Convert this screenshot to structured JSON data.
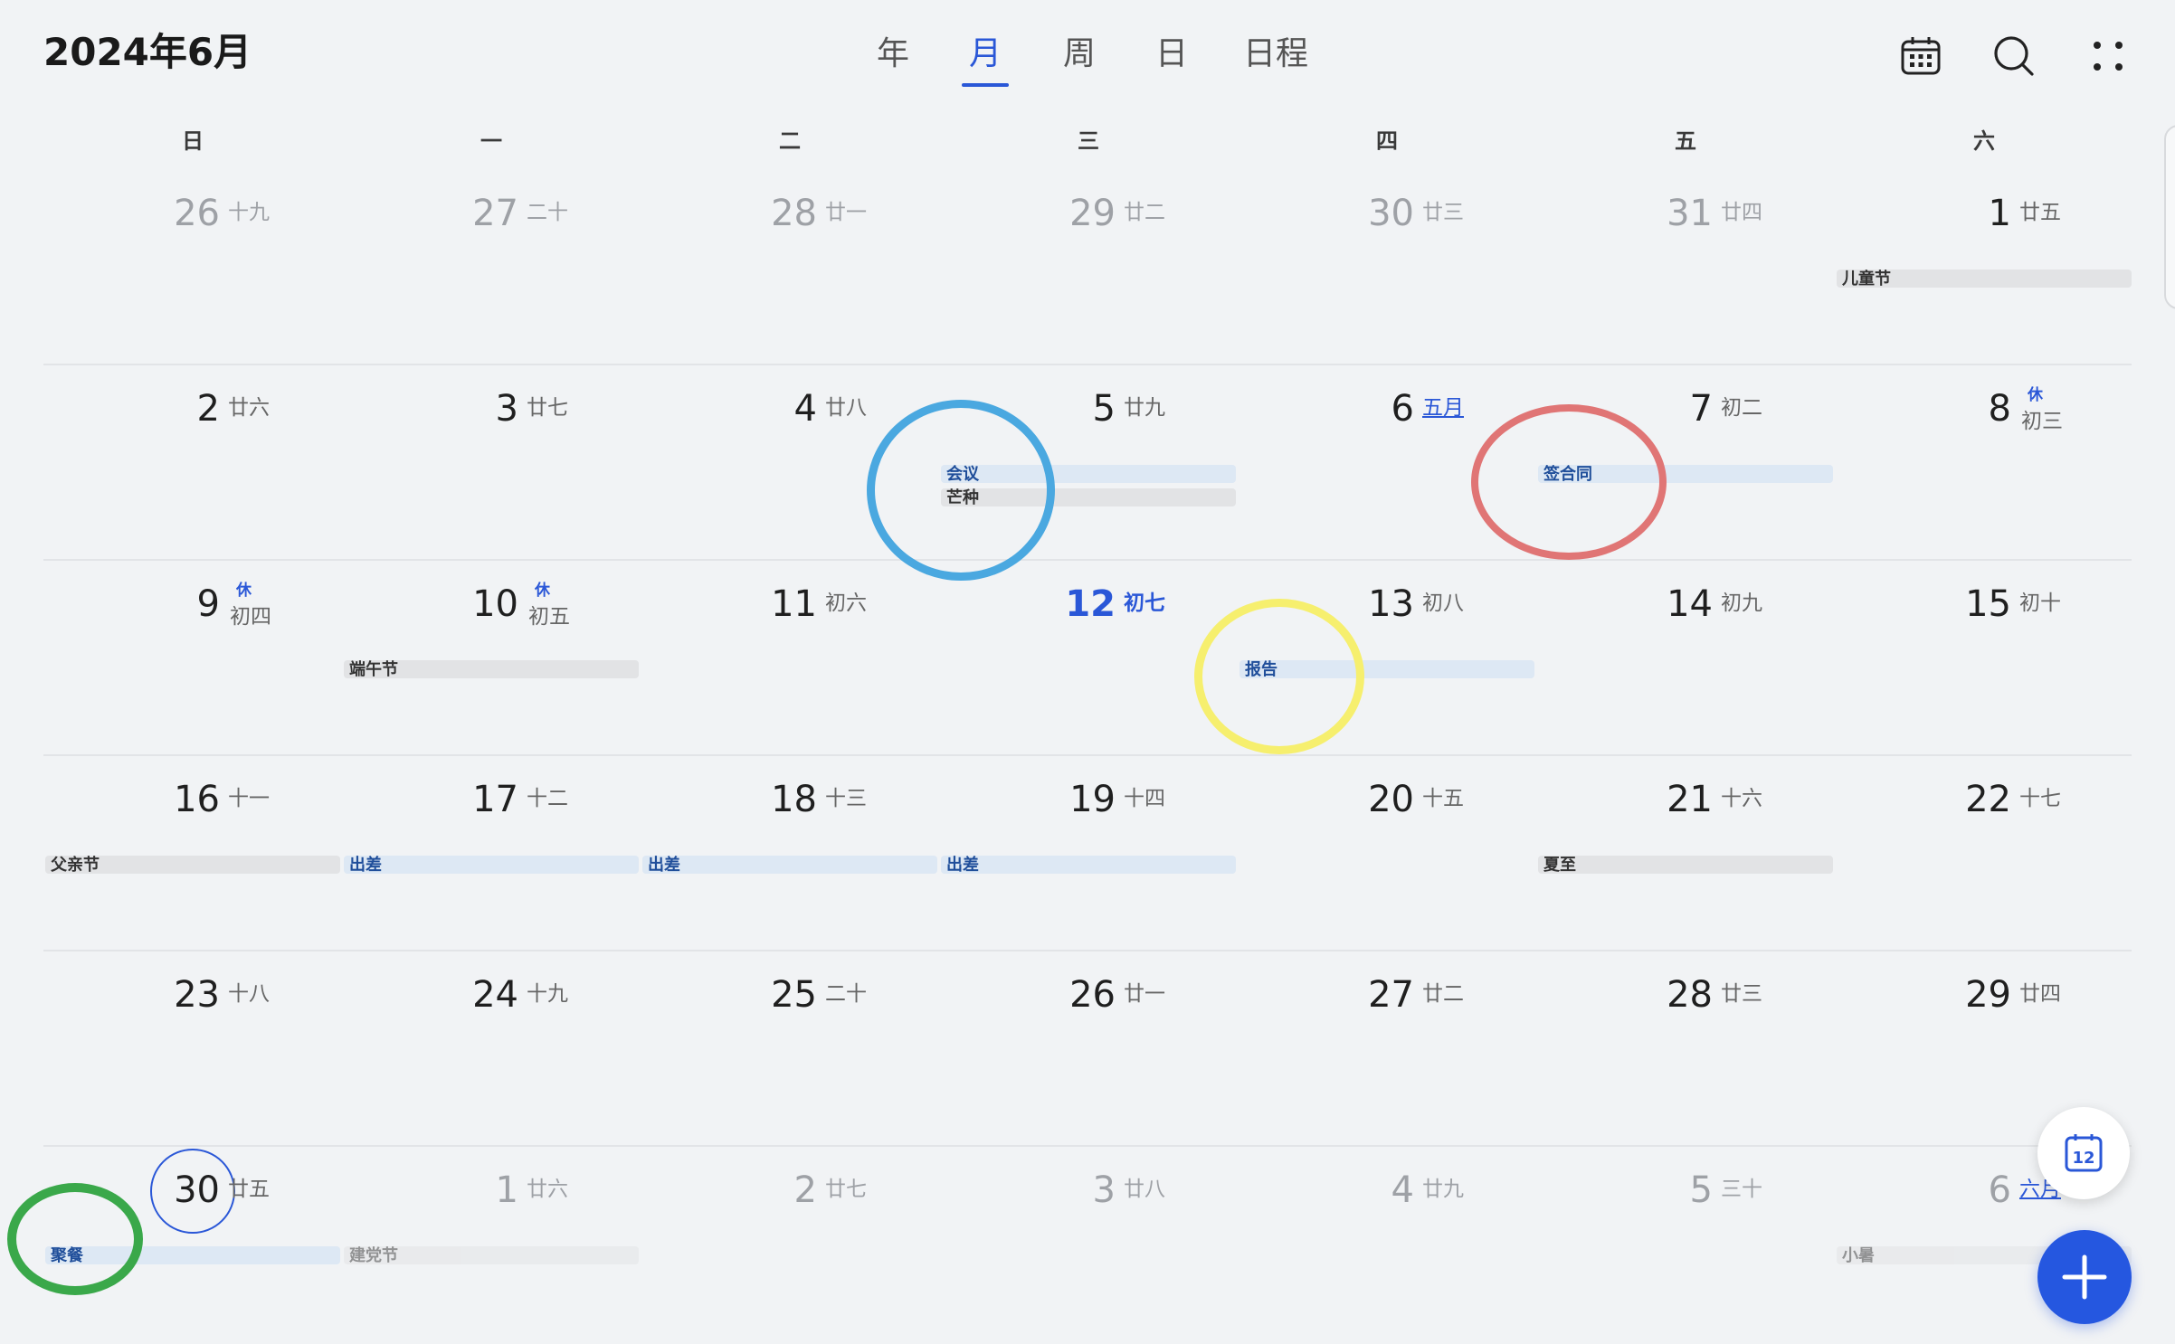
{
  "header": {
    "title": "2024年6月",
    "view_tabs": [
      {
        "label": "年",
        "active": false
      },
      {
        "label": "月",
        "active": true
      },
      {
        "label": "周",
        "active": false
      },
      {
        "label": "日",
        "active": false
      },
      {
        "label": "日程",
        "active": false
      }
    ],
    "icons": [
      "calendar-grid-icon",
      "search-icon",
      "more-dots-icon"
    ]
  },
  "weekdays": [
    "日",
    "一",
    "二",
    "三",
    "四",
    "五",
    "六"
  ],
  "weeks": [
    {
      "days": [
        {
          "day": "26",
          "lunar": "十九",
          "other_month": true
        },
        {
          "day": "27",
          "lunar": "二十",
          "other_month": true
        },
        {
          "day": "28",
          "lunar": "廿一",
          "other_month": true
        },
        {
          "day": "29",
          "lunar": "廿二",
          "other_month": true
        },
        {
          "day": "30",
          "lunar": "廿三",
          "other_month": true
        },
        {
          "day": "31",
          "lunar": "廿四",
          "other_month": true
        },
        {
          "day": "1",
          "lunar": "廿五"
        }
      ]
    },
    {
      "days": [
        {
          "day": "2",
          "lunar": "廿六"
        },
        {
          "day": "3",
          "lunar": "廿七"
        },
        {
          "day": "4",
          "lunar": "廿八"
        },
        {
          "day": "5",
          "lunar": "廿九"
        },
        {
          "day": "6",
          "lunar": "五月",
          "lunar_link": true
        },
        {
          "day": "7",
          "lunar": "初二"
        },
        {
          "day": "8",
          "lunar": "初三",
          "badge": "休"
        }
      ]
    },
    {
      "days": [
        {
          "day": "9",
          "lunar": "初四",
          "badge": "休"
        },
        {
          "day": "10",
          "lunar": "初五",
          "badge": "休"
        },
        {
          "day": "11",
          "lunar": "初六"
        },
        {
          "day": "12",
          "lunar": "初七",
          "today": true
        },
        {
          "day": "13",
          "lunar": "初八"
        },
        {
          "day": "14",
          "lunar": "初九"
        },
        {
          "day": "15",
          "lunar": "初十"
        }
      ]
    },
    {
      "days": [
        {
          "day": "16",
          "lunar": "十一"
        },
        {
          "day": "17",
          "lunar": "十二"
        },
        {
          "day": "18",
          "lunar": "十三"
        },
        {
          "day": "19",
          "lunar": "十四"
        },
        {
          "day": "20",
          "lunar": "十五"
        },
        {
          "day": "21",
          "lunar": "十六"
        },
        {
          "day": "22",
          "lunar": "十七"
        }
      ]
    },
    {
      "days": [
        {
          "day": "23",
          "lunar": "十八"
        },
        {
          "day": "24",
          "lunar": "十九"
        },
        {
          "day": "25",
          "lunar": "二十"
        },
        {
          "day": "26",
          "lunar": "廿一"
        },
        {
          "day": "27",
          "lunar": "廿二"
        },
        {
          "day": "28",
          "lunar": "廿三"
        },
        {
          "day": "29",
          "lunar": "廿四"
        }
      ]
    },
    {
      "days": [
        {
          "day": "30",
          "lunar": "廿五",
          "selected": true
        },
        {
          "day": "1",
          "lunar": "廿六",
          "other_month": true
        },
        {
          "day": "2",
          "lunar": "廿七",
          "other_month": true
        },
        {
          "day": "3",
          "lunar": "廿八",
          "other_month": true
        },
        {
          "day": "4",
          "lunar": "廿九",
          "other_month": true
        },
        {
          "day": "5",
          "lunar": "三十",
          "other_month": true
        },
        {
          "day": "6",
          "lunar": "六月",
          "other_month": true,
          "lunar_link": true
        }
      ]
    }
  ],
  "events": [
    {
      "title": "儿童节",
      "week": 0,
      "col": 6,
      "slot": 0,
      "style": "gray"
    },
    {
      "title": "会议",
      "week": 1,
      "col": 3,
      "slot": 0,
      "style": "blue"
    },
    {
      "title": "芒种",
      "week": 1,
      "col": 3,
      "slot": 1,
      "style": "gray"
    },
    {
      "title": "签合同",
      "week": 1,
      "col": 5,
      "slot": 0,
      "style": "blue"
    },
    {
      "title": "端午节",
      "week": 2,
      "col": 1,
      "slot": 0,
      "style": "gray"
    },
    {
      "title": "报告",
      "week": 2,
      "col": 4,
      "slot": 0,
      "style": "blue"
    },
    {
      "title": "父亲节",
      "week": 3,
      "col": 0,
      "slot": 0,
      "style": "gray"
    },
    {
      "title": "出差",
      "week": 3,
      "col": 1,
      "slot": 0,
      "style": "blue"
    },
    {
      "title": "出差",
      "week": 3,
      "col": 2,
      "slot": 0,
      "style": "blue"
    },
    {
      "title": "出差",
      "week": 3,
      "col": 3,
      "slot": 0,
      "style": "blue"
    },
    {
      "title": "夏至",
      "week": 3,
      "col": 5,
      "slot": 0,
      "style": "gray"
    },
    {
      "title": "聚餐",
      "week": 5,
      "col": 0,
      "slot": 0,
      "style": "blue"
    },
    {
      "title": "建党节",
      "week": 5,
      "col": 1,
      "slot": 0,
      "style": "gray",
      "dim": true
    },
    {
      "title": "小暑",
      "week": 5,
      "col": 6,
      "slot": 0,
      "style": "gray",
      "dim": true
    }
  ],
  "annotations": [
    {
      "name": "meeting-annotation-circle",
      "color": "#4aa8e0"
    },
    {
      "name": "contract-annotation-circle",
      "color": "#e07575"
    },
    {
      "name": "report-annotation-circle",
      "color": "#f6ef6e"
    },
    {
      "name": "dinner-annotation-circle",
      "color": "#3aa84a"
    }
  ],
  "fab": {
    "today_label": "12",
    "today_icon": "calendar-today-icon",
    "add_icon": "plus-icon"
  },
  "colors": {
    "accent": "#2a57d7",
    "background": "#f1f3f5",
    "event_blue_bg": "#dde8f4",
    "event_gray_bg": "#e2e3e5"
  }
}
